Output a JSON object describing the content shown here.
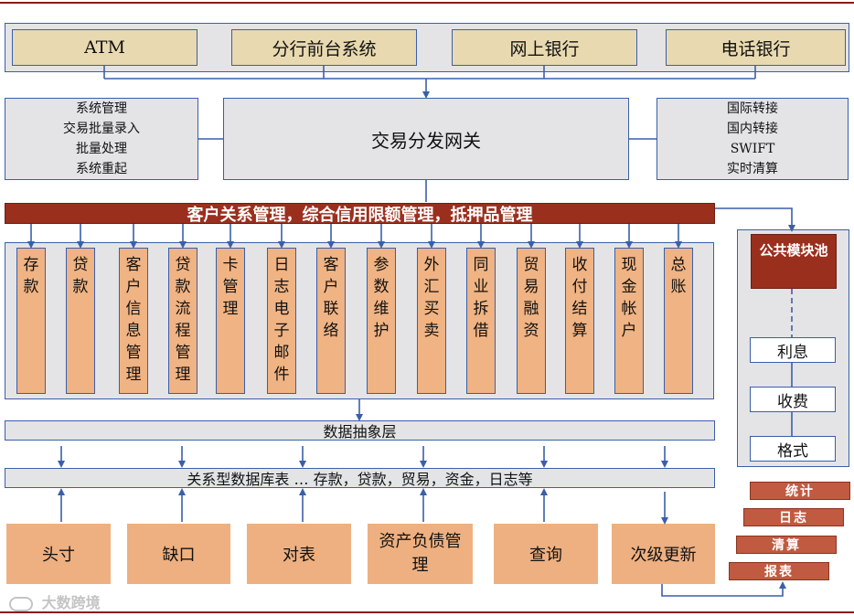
{
  "channels": [
    "ATM",
    "分行前台系统",
    "网上银行",
    "电话银行"
  ],
  "left_box": [
    "系统管理",
    "交易批量录入",
    "批量处理",
    "系统重起"
  ],
  "gateway": "交易分发网关",
  "right_box": [
    "国际转接",
    "国内转接",
    "SWIFT",
    "实时清算"
  ],
  "crm_bar": "客户关系管理，综合信用限额管理，抵押品管理",
  "modules": [
    "存款",
    "贷款",
    "客户信息管理",
    "贷款流程管理",
    "卡管理",
    "日志电子邮件",
    "客户联络",
    "参数维护",
    "外汇买卖",
    "同业拆借",
    "贸易融资",
    "收付结算",
    "现金帐户",
    "总账"
  ],
  "common_pool": {
    "title": "公共模块池",
    "items": [
      "利息",
      "收费",
      "格式"
    ]
  },
  "data_abstraction": "数据抽象层",
  "relational_db": "关系型数据库表 … 存款，贷款，贸易，资金，日志等",
  "bottom_boxes": [
    "头寸",
    "缺口",
    "对表",
    "资产负债管理",
    "查询",
    "次级更新"
  ],
  "right_buttons": [
    "统计",
    "日志",
    "清算",
    "报表"
  ],
  "watermark": "大数跨境",
  "colors": {
    "crm_red": "#9b2f1e",
    "module_orange": "#f0b383",
    "channel_tan": "#e8d9b0",
    "panel_gray": "#e4e4e6",
    "line_blue": "#3a5fa8"
  }
}
